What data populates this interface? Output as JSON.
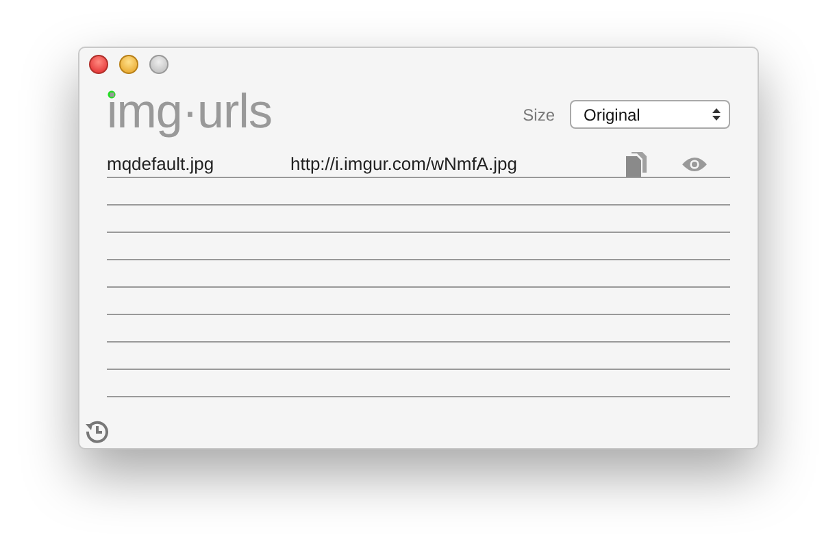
{
  "logo": "img·urls",
  "size": {
    "label": "Size",
    "value": "Original"
  },
  "rows": [
    {
      "name": "mqdefault.jpg",
      "url": "http://i.imgur.com/wNmfA.jpg"
    }
  ]
}
